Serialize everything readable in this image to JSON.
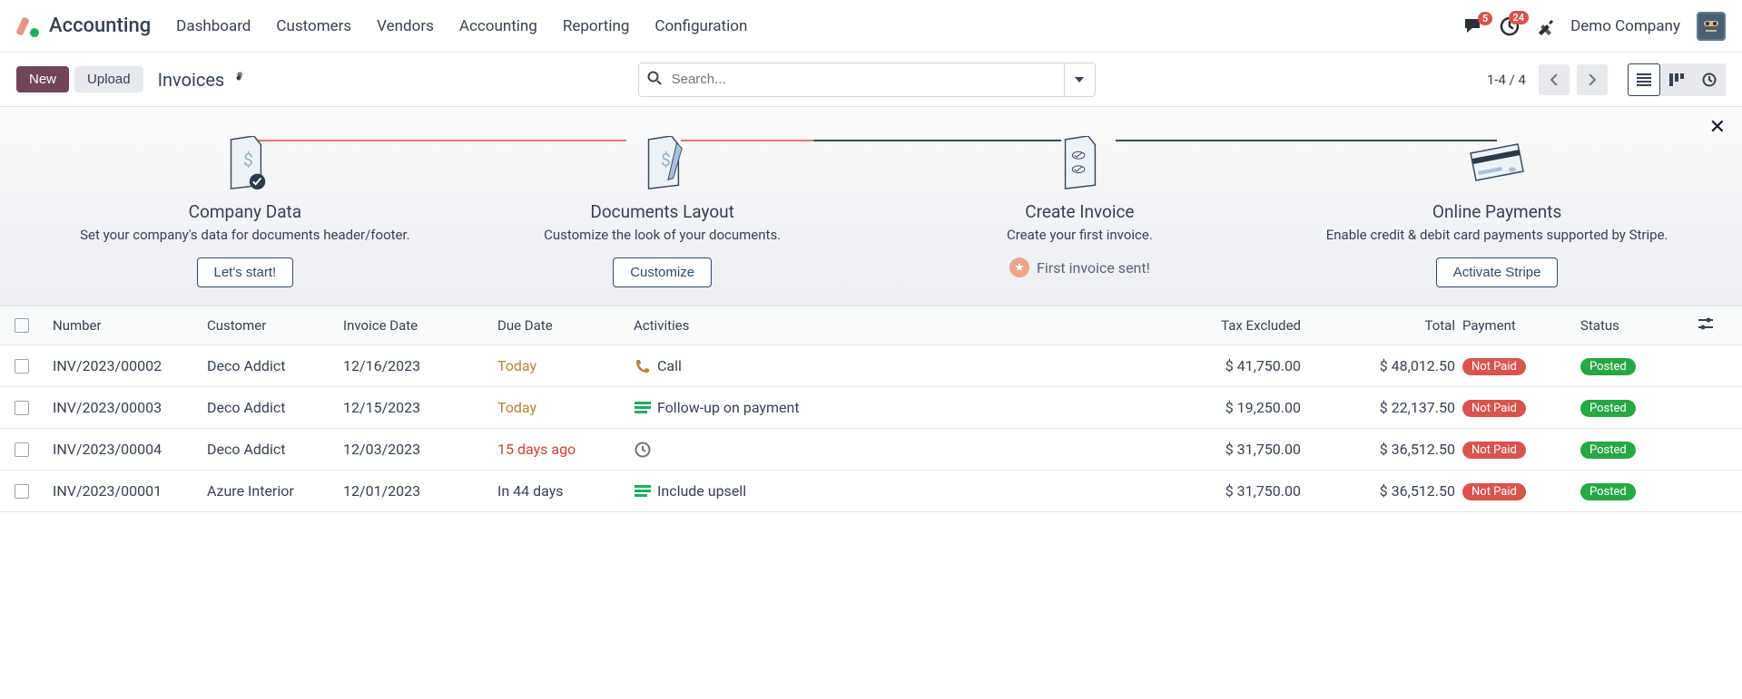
{
  "nav": {
    "appName": "Accounting",
    "links": [
      "Dashboard",
      "Customers",
      "Vendors",
      "Accounting",
      "Reporting",
      "Configuration"
    ],
    "badge_messages": "5",
    "badge_activities": "24",
    "company": "Demo Company"
  },
  "toolbar": {
    "new": "New",
    "upload": "Upload",
    "title": "Invoices",
    "searchPlaceholder": "Search...",
    "pager": "1-4 / 4"
  },
  "onboard": {
    "steps": [
      {
        "title": "Company Data",
        "desc": "Set your company's data for documents header/footer.",
        "action": "Let's start!"
      },
      {
        "title": "Documents Layout",
        "desc": "Customize the look of your documents.",
        "action": "Customize"
      },
      {
        "title": "Create Invoice",
        "desc": "Create your first invoice.",
        "doneText": "First invoice sent!"
      },
      {
        "title": "Online Payments",
        "desc": "Enable credit & debit card payments supported by Stripe.",
        "action": "Activate Stripe"
      }
    ]
  },
  "table": {
    "headers": {
      "number": "Number",
      "customer": "Customer",
      "invoiceDate": "Invoice Date",
      "dueDate": "Due Date",
      "activities": "Activities",
      "taxExcluded": "Tax Excluded",
      "total": "Total",
      "payment": "Payment",
      "status": "Status"
    },
    "rows": [
      {
        "number": "INV/2023/00002",
        "customer": "Deco Addict",
        "invoiceDate": "12/16/2023",
        "dueDate": "Today",
        "dueClass": "amber",
        "activityIcon": "phone",
        "activityText": "Call",
        "taxExcluded": "$ 41,750.00",
        "total": "$ 48,012.50",
        "payment": "Not Paid",
        "status": "Posted"
      },
      {
        "number": "INV/2023/00003",
        "customer": "Deco Addict",
        "invoiceDate": "12/15/2023",
        "dueDate": "Today",
        "dueClass": "amber",
        "activityIcon": "bars-green",
        "activityText": "Follow-up on payment",
        "taxExcluded": "$ 19,250.00",
        "total": "$ 22,137.50",
        "payment": "Not Paid",
        "status": "Posted"
      },
      {
        "number": "INV/2023/00004",
        "customer": "Deco Addict",
        "invoiceDate": "12/03/2023",
        "dueDate": "15 days ago",
        "dueClass": "red",
        "activityIcon": "clock",
        "activityText": "",
        "taxExcluded": "$ 31,750.00",
        "total": "$ 36,512.50",
        "payment": "Not Paid",
        "status": "Posted"
      },
      {
        "number": "INV/2023/00001",
        "customer": "Azure Interior",
        "invoiceDate": "12/01/2023",
        "dueDate": "In 44 days",
        "dueClass": "",
        "activityIcon": "bars-green",
        "activityText": "Include upsell",
        "taxExcluded": "$ 31,750.00",
        "total": "$ 36,512.50",
        "payment": "Not Paid",
        "status": "Posted"
      }
    ]
  }
}
